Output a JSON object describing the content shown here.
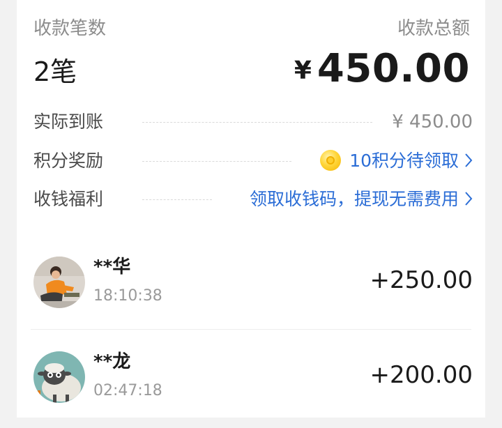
{
  "summary": {
    "count_label": "收款笔数",
    "total_label": "收款总额",
    "count_value": "2笔",
    "currency_symbol": "¥",
    "total_amount": "450.00"
  },
  "details": [
    {
      "label": "实际到账",
      "value": "¥ 450.00"
    },
    {
      "label": "积分奖励",
      "value": "10积分待领取",
      "icon": "coin-icon"
    },
    {
      "label": "收钱福利",
      "value": "领取收钱码，提现无需费用"
    }
  ],
  "transactions": [
    {
      "name": "**华",
      "time": "18:10:38",
      "amount": "+250.00"
    },
    {
      "name": "**龙",
      "time": "02:47:18",
      "amount": "+200.00"
    }
  ],
  "colors": {
    "link": "#2b6dd6",
    "muted": "#8c8c8c",
    "text": "#1a1a1a"
  }
}
